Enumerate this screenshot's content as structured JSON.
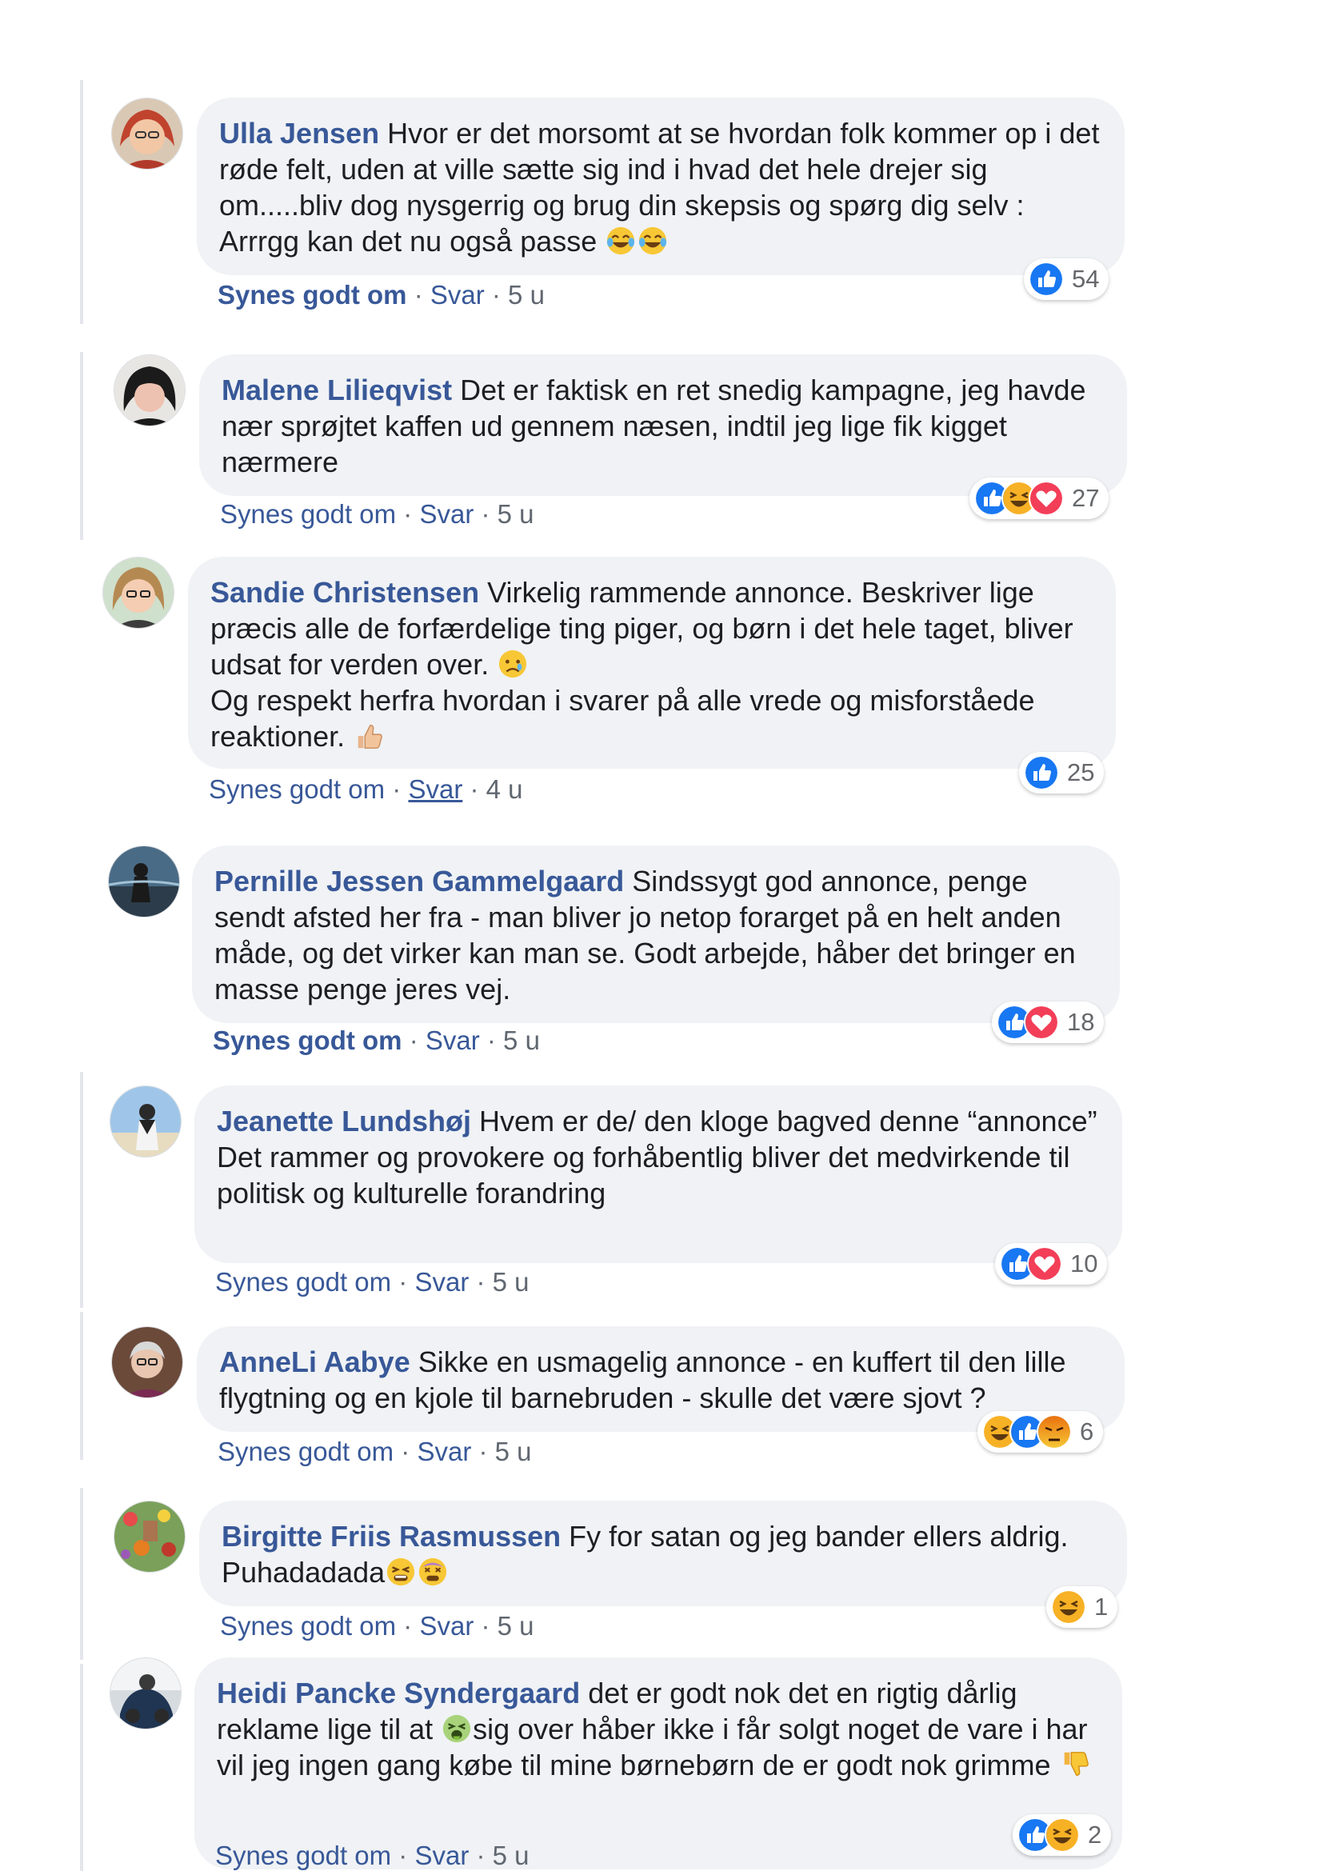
{
  "comments": [
    {
      "author": "Ulla Jensen",
      "text": " Hvor er det morsomt at se hvordan folk kommer op i det røde felt, uden at ville sætte sig ind i hvad det hele drejer sig om.....bliv dog nysgerrig og brug din skepsis og spørg dig selv : Arrrgg kan det nu også passe",
      "emojis": [
        "tears-of-joy-emoji",
        "tears-of-joy-emoji"
      ],
      "like_label": "Synes godt om",
      "reply_label": "Svar",
      "time": "5 u",
      "reactions": [
        "like"
      ],
      "reaction_count": "54"
    },
    {
      "author": "Malene Lilieqvist",
      "text": " Det er faktisk en ret snedig kampagne, jeg havde nær sprøjtet kaffen ud gennem næsen, indtil jeg lige fik kigget nærmere",
      "emojis": [],
      "like_label": "Synes godt om",
      "reply_label": "Svar",
      "time": "5 u",
      "reactions": [
        "like",
        "haha",
        "love"
      ],
      "reaction_count": "27"
    },
    {
      "author": "Sandie Christensen",
      "text": " Virkelig rammende annonce. Beskriver lige præcis alle de forfærdelige ting piger, og børn i det hele taget, bliver udsat for verden over. ",
      "text2": "Og respekt herfra hvordan i svarer på alle vrede og misforståede reaktioner. ",
      "emojis": [
        "sad-tear-emoji"
      ],
      "emojis2": [
        "thumbs-up-emoji"
      ],
      "like_label": "Synes godt om",
      "reply_label": "Svar",
      "time": "4 u",
      "reactions": [
        "like"
      ],
      "reaction_count": "25"
    },
    {
      "author": "Pernille Jessen Gammelgaard",
      "text": " Sindssygt god annonce, penge sendt afsted her fra - man bliver jo netop forarget på en helt anden måde, og det virker kan man se. Godt arbejde, håber det bringer en masse penge jeres vej.",
      "emojis": [],
      "like_label": "Synes godt om",
      "reply_label": "Svar",
      "time": "5 u",
      "reactions": [
        "like",
        "love"
      ],
      "reaction_count": "18"
    },
    {
      "author": "Jeanette Lundshøj",
      "text": " Hvem er de/ den kloge bagved denne “annonce”",
      "text2": "Det rammer og provokere og forhåbentlig bliver det medvirkende til politisk og kulturelle forandring",
      "emojis": [],
      "like_label": "Synes godt om",
      "reply_label": "Svar",
      "time": "5 u",
      "reactions": [
        "like",
        "love"
      ],
      "reaction_count": "10"
    },
    {
      "author": "AnneLi Aabye",
      "text": " Sikke en usmagelig annonce - en kuffert til den lille flygtning og en kjole til barnebruden - skulle det være sjovt ?",
      "emojis": [],
      "like_label": "Synes godt om",
      "reply_label": "Svar",
      "time": "5 u",
      "reactions": [
        "haha",
        "like",
        "angry"
      ],
      "reaction_count": "6"
    },
    {
      "author": "Birgitte Friis Rasmussen",
      "text": " Fy for satan og jeg bander ellers aldrig. Puhadadada",
      "emojis": [
        "tired-face-emoji",
        "dizzy-face-emoji"
      ],
      "like_label": "Synes godt om",
      "reply_label": "Svar",
      "time": "5 u",
      "reactions": [
        "haha"
      ],
      "reaction_count": "1"
    },
    {
      "author": "Heidi Pancke Syndergaard",
      "text_a": " det er godt nok det en rigtig dårlig reklame lige til at ",
      "text_b": "sig over håber ikke i får solgt noget de vare i har vil jeg ingen gang købe til mine børnebørn de er godt nok grimme ",
      "emojis": [
        "vomiting-face-emoji"
      ],
      "emojis2": [
        "thumbs-down-emoji"
      ],
      "like_label": "Synes godt om",
      "reply_label": "Svar",
      "time": "5 u",
      "reactions": [
        "like",
        "haha"
      ],
      "reaction_count": "2"
    }
  ],
  "colors": {
    "author": "#385898",
    "bubble": "#f0f2f5",
    "meta": "#606770",
    "like_blue": "#1877f2",
    "love_red": "#f33e58",
    "haha_yellow": "#f7b125",
    "angry_orange": "#e9710f"
  }
}
